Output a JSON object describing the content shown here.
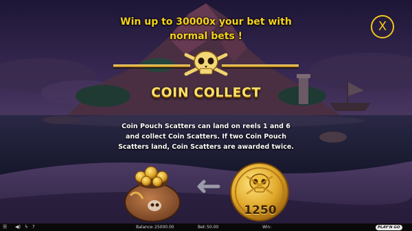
{
  "headline": {
    "line1": "Win up to 30000x your bet with",
    "line2": "normal bets !"
  },
  "close_label": "X",
  "feature": {
    "title": "COIN COLLECT",
    "description_lines": [
      "Coin Pouch Scatters can land on reels 1 and 6",
      "and collect Coin Scatters. If two Coin Pouch",
      "Scatters land, Coin Scatters are awarded twice."
    ]
  },
  "coin": {
    "value": "1250"
  },
  "status_bar": {
    "balance_label": "Balance:",
    "balance_value": "25000.00",
    "bet_label": "Bet:",
    "bet_value": "50.00",
    "win_label": "Win:",
    "win_value": "",
    "provider_logo": "PLAY'N GO"
  },
  "icons": {
    "menu": "hamburger-menu-icon",
    "sound": "speaker-icon",
    "turbo": "lightning-icon",
    "help": "question-icon"
  },
  "colors": {
    "accent_gold": "#f5d31b",
    "title_gold": "#ffe066",
    "background": "#1a1430",
    "bar": "#090909"
  }
}
